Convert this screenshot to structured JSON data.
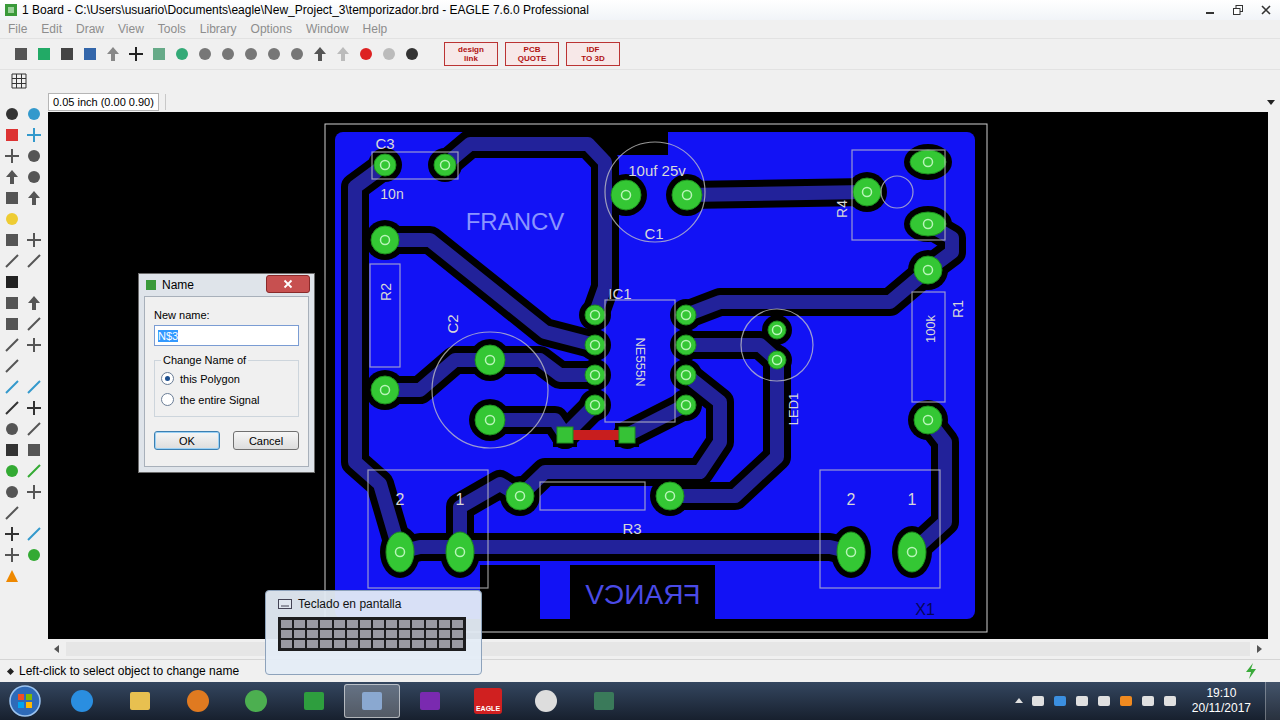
{
  "window": {
    "title": "1 Board - C:\\Users\\usuario\\Documents\\eagle\\New_Project_3\\temporizador.brd - EAGLE 7.6.0 Professional"
  },
  "menu": [
    {
      "label": "File",
      "disabled": true
    },
    {
      "label": "Edit",
      "disabled": true
    },
    {
      "label": "Draw",
      "disabled": true
    },
    {
      "label": "View",
      "disabled": true
    },
    {
      "label": "Tools",
      "disabled": true
    },
    {
      "label": "Library",
      "disabled": true
    },
    {
      "label": "Options",
      "disabled": true
    },
    {
      "label": "Window",
      "disabled": true
    },
    {
      "label": "Help",
      "disabled": true
    }
  ],
  "toolbar": {
    "links": [
      {
        "lines": [
          "design",
          "link"
        ]
      },
      {
        "lines": [
          "PCB",
          "QUOTE"
        ]
      },
      {
        "lines": [
          "IDF",
          "TO 3D"
        ]
      }
    ]
  },
  "coordinates": "0.05 inch (0.00 0.90)",
  "board": {
    "labels": [
      {
        "text": "C3",
        "mirrored": false
      },
      {
        "text": "10n",
        "mirrored": false
      },
      {
        "text": "10uf 25v",
        "mirrored": false
      },
      {
        "text": "C1",
        "mirrored": false
      },
      {
        "text": "FRANCV",
        "mirrored": false
      },
      {
        "text": "R4",
        "mirrored": false
      },
      {
        "text": "R2",
        "mirrored": false
      },
      {
        "text": "C2",
        "mirrored": false
      },
      {
        "text": "IC1",
        "mirrored": false
      },
      {
        "text": "NE555N",
        "mirrored": false
      },
      {
        "text": "R1",
        "mirrored": false
      },
      {
        "text": "100k",
        "mirrored": false
      },
      {
        "text": "LED1",
        "mirrored": false
      },
      {
        "text": "R3",
        "mirrored": false
      },
      {
        "text": "2",
        "mirrored": false
      },
      {
        "text": "1",
        "mirrored": false
      },
      {
        "text": "2",
        "mirrored": false
      },
      {
        "text": "1",
        "mirrored": false
      },
      {
        "text": "X1",
        "mirrored": false
      },
      {
        "text": "FRANCV",
        "mirrored": true
      }
    ]
  },
  "status_bar": {
    "message": "Left-click to select object to change name"
  },
  "dialog": {
    "title": "Name",
    "field_label": "New name:",
    "value": "N$3",
    "value_selected": true,
    "group": "Change Name of",
    "options": [
      {
        "label": "this Polygon",
        "selected": true
      },
      {
        "label": "the entire Signal",
        "selected": false
      }
    ],
    "buttons": [
      {
        "label": "OK",
        "default": true
      },
      {
        "label": "Cancel",
        "default": false
      }
    ]
  },
  "thumbnail": {
    "title": "Teclado en pantalla"
  },
  "taskbar": {
    "eagle_badge": "EAGLE",
    "time": "19:10",
    "date": "20/11/2017",
    "apps": [
      {
        "selected": false
      },
      {
        "selected": false
      },
      {
        "selected": false
      },
      {
        "selected": false
      },
      {
        "selected": false
      },
      {
        "selected": true
      },
      {
        "selected": false
      },
      {
        "selected": false
      },
      {
        "selected": false
      },
      {
        "selected": false
      }
    ]
  }
}
